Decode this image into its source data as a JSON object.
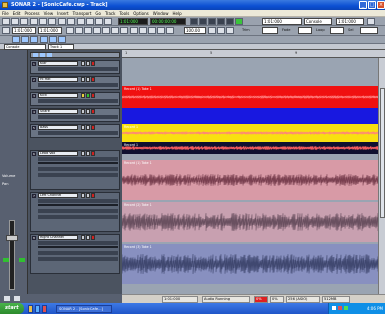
{
  "window": {
    "title": "SONAR 2 - [SonicCafe.cwp - Track]",
    "controls": [
      "minimize-icon",
      "maximize-icon",
      "close-icon"
    ]
  },
  "menu": {
    "items": [
      "File",
      "Edit",
      "Process",
      "View",
      "Insert",
      "Transport",
      "Go",
      "Track",
      "Tools",
      "Options",
      "Window",
      "Help"
    ]
  },
  "toolbar": {
    "time_display": "1:01:000",
    "smpte_display": "00:00:00:00",
    "position_field": "1:01:000",
    "position_field_2": "1:01:000",
    "tempo_field": "100.00",
    "snap_labels": [
      "Trim",
      "Fade",
      "Loop",
      "Sel"
    ],
    "workspace_field": "Console",
    "track_label": "Track 1"
  },
  "ruler": {
    "marks": [
      "1",
      "5",
      "9"
    ]
  },
  "tracks": [
    {
      "num": "1",
      "name": "Klar",
      "color": "#c8ccd4"
    },
    {
      "num": "2",
      "name": "Hi Hat",
      "color": "#c8ccd4"
    },
    {
      "num": "3",
      "name": "Kick",
      "color": "#c8ccd4"
    },
    {
      "num": "4",
      "name": "Snare",
      "color": "#c8ccd4"
    },
    {
      "num": "5",
      "name": "Bass",
      "color": "#c8ccd4"
    },
    {
      "num": "6",
      "name": "Lead Vox",
      "color": "#c8ccd4"
    },
    {
      "num": "7",
      "name": "Left Channel",
      "color": "#c8ccd4"
    },
    {
      "num": "8",
      "name": "Right Channel",
      "color": "#c8ccd4"
    }
  ],
  "clips": [
    {
      "label": "Record (1) Take 1",
      "color": "#f01010",
      "waveform": "#ff8080"
    },
    {
      "label": "",
      "color": "#1818e0",
      "waveform": "#8080ff"
    },
    {
      "label": "Record 1",
      "color": "#f8e010",
      "waveform": "#ff8080"
    },
    {
      "label": "Record 1",
      "color": "#101030",
      "waveform": "#ff6060"
    },
    {
      "label": "Record (1) Take 1",
      "color": "#d89aa6",
      "waveform": "#7a4050"
    },
    {
      "label": "Record (2) Take 1",
      "color": "#c8a0b0",
      "waveform": "#6a5060"
    },
    {
      "label": "Record (3) Take 1",
      "color": "#8890c0",
      "waveform": "#404870"
    }
  ],
  "left_strip": {
    "labels": [
      "Volume",
      "Pan"
    ]
  },
  "status": {
    "position": "1:01:000",
    "mode": "Audio Running",
    "disk": "0%",
    "cpu": "0%",
    "audio_engine": "256 (ASIO)",
    "memory": "512MB"
  },
  "taskbar": {
    "start_label": "start",
    "items": [
      "SONAR 2 - [SonicCafe...]"
    ],
    "clock": "4:06 PM"
  }
}
